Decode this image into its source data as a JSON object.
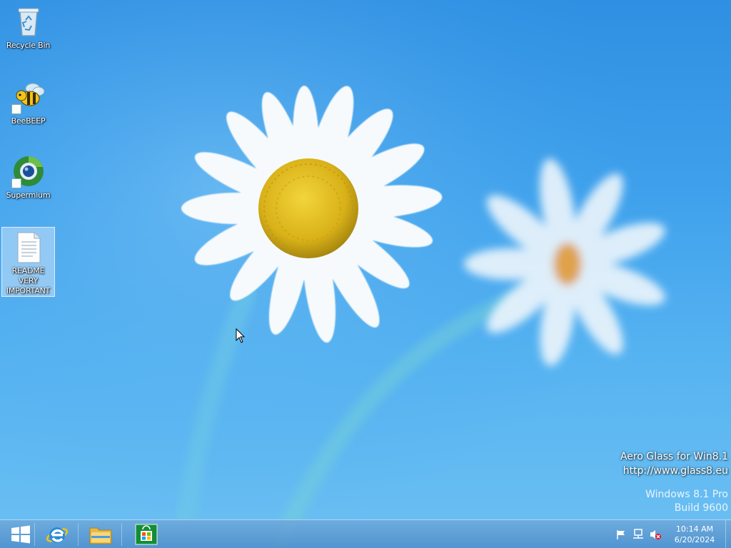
{
  "desktop": {
    "icons": [
      {
        "label": "Recycle Bin",
        "icon": "recycle-bin-icon"
      },
      {
        "label": "BeeBEEP",
        "icon": "bee-icon"
      },
      {
        "label": "Supermium",
        "icon": "supermium-browser-icon"
      },
      {
        "label_lines": [
          "README",
          "VERY",
          "IMPORTANT"
        ],
        "icon": "text-document-icon",
        "selected": true
      }
    ]
  },
  "watermark": {
    "aero_line1": "Aero Glass for Win8.1",
    "aero_line2": "http://www.glass8.eu",
    "os_line1": "Windows 8.1 Pro",
    "os_line2": "Build 9600"
  },
  "taskbar": {
    "start": "windows-start-icon",
    "pinned": [
      {
        "name": "Internet Explorer",
        "icon": "internet-explorer-icon"
      },
      {
        "name": "File Explorer",
        "icon": "file-explorer-icon"
      },
      {
        "name": "Store",
        "icon": "store-icon"
      }
    ],
    "tray": {
      "icons": [
        "action-center-flag-icon",
        "network-icon",
        "volume-muted-icon"
      ],
      "time": "10:14 AM",
      "date": "6/20/2024"
    }
  },
  "colors": {
    "desktop_blue": "#3fa1ec",
    "taskbar": "#5a98d0",
    "daisy_center": "#e7c21a"
  }
}
